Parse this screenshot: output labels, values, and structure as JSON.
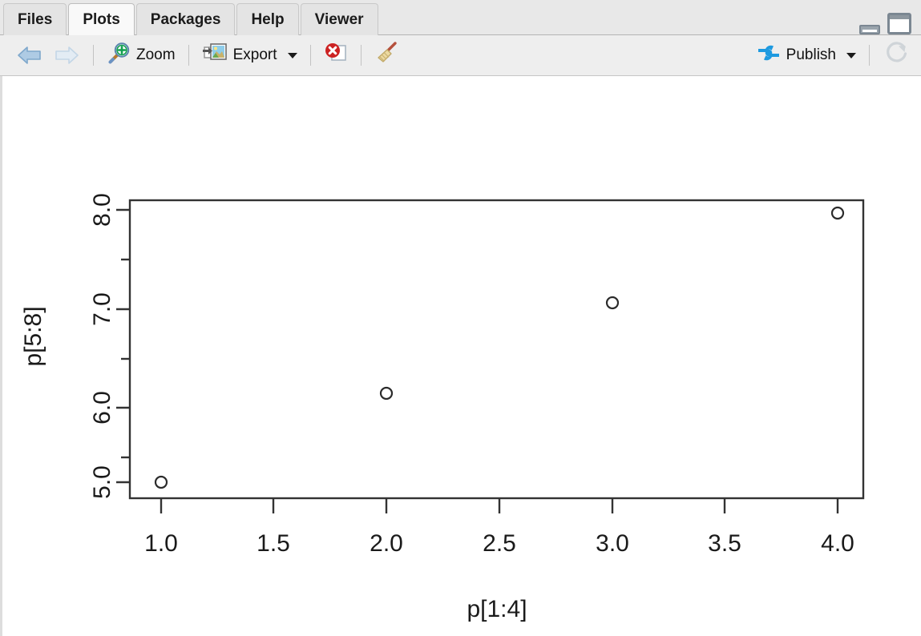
{
  "window": {
    "tabs": [
      {
        "id": "files",
        "label": "Files",
        "active": false
      },
      {
        "id": "plots",
        "label": "Plots",
        "active": true
      },
      {
        "id": "packages",
        "label": "Packages",
        "active": false
      },
      {
        "id": "help",
        "label": "Help",
        "active": false
      },
      {
        "id": "viewer",
        "label": "Viewer",
        "active": false
      }
    ],
    "controls": {
      "minimize": "minimize-icon",
      "maximize": "maximize-icon"
    }
  },
  "toolbar": {
    "back_icon": "back-arrow-icon",
    "forward_icon": "forward-arrow-icon",
    "zoom_label": "Zoom",
    "zoom_icon": "magnifier-plus-icon",
    "export_label": "Export",
    "export_icon": "image-export-icon",
    "export_caret": "chevron-down-icon",
    "remove_plot_icon": "remove-plot-icon",
    "clear_plots_icon": "broom-icon",
    "publish_label": "Publish",
    "publish_icon": "publish-icon",
    "publish_caret": "chevron-down-icon",
    "refresh_icon": "refresh-icon"
  },
  "colors": {
    "tabbar_bg": "#e8e8e8",
    "tab_active_bg": "#f9f9f9",
    "toolbar_bg": "#eeeeee",
    "plot_bg": "#ffffff",
    "axis": "#333333",
    "publish_blue": "#1e9ae0",
    "remove_red": "#cc2222",
    "zoom_green": "#12a050"
  },
  "chart_data": {
    "type": "scatter",
    "title": "",
    "xlabel": "p[1:4]",
    "ylabel": "p[5:8]",
    "x": [
      1,
      2,
      3,
      4
    ],
    "y": [
      5,
      6,
      7,
      8
    ],
    "xlim": [
      0.85,
      4.15
    ],
    "ylim": [
      4.85,
      8.15
    ],
    "xticks": [
      1.0,
      1.5,
      2.0,
      2.5,
      3.0,
      3.5,
      4.0
    ],
    "xticklabels": [
      "1.0",
      "1.5",
      "2.0",
      "2.5",
      "3.0",
      "3.5",
      "4.0"
    ],
    "yticks": [
      5.0,
      5.5,
      6.0,
      6.5,
      7.0,
      7.5,
      8.0
    ],
    "yticklabels": [
      "5.0",
      "",
      "6.0",
      "",
      "7.0",
      "",
      "8.0"
    ],
    "grid": false,
    "legend": null,
    "marker": "open-circle",
    "marker_size": 6,
    "box": true
  }
}
